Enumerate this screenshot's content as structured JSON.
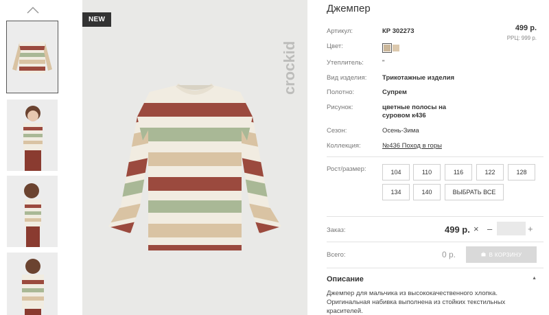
{
  "product": {
    "badge": "NEW",
    "brand": "crockid",
    "title": "Джемпер",
    "price": "499 р.",
    "rrc": "РРЦ: 999 р."
  },
  "details": [
    {
      "label": "Артикул:",
      "value": "КР 302273"
    },
    {
      "label": "Цвет:",
      "value": ""
    },
    {
      "label": "Утеплитель:",
      "value": "\""
    },
    {
      "label": "Вид изделия:",
      "value": "Трикотажные изделия"
    },
    {
      "label": "Полотно:",
      "value": "Супрем"
    },
    {
      "label": "Рисунок:",
      "value": "цветные полосы на суровом к436"
    },
    {
      "label": "Сезон:",
      "value": "Осень-Зима"
    },
    {
      "label": "Коллекция:",
      "value": "№436 Поход в горы"
    }
  ],
  "colors": [
    "#cbb79a",
    "#dcc9ae"
  ],
  "sizes": {
    "label": "Рост/размер:",
    "options": [
      "104",
      "110",
      "116",
      "122",
      "128",
      "134",
      "140"
    ],
    "select_all": "ВЫБРАТЬ ВСЕ"
  },
  "order": {
    "label": "Заказ:",
    "price": "499 р.",
    "multiply": "×",
    "minus": "–",
    "quantity": "",
    "plus": "+"
  },
  "total": {
    "label": "Всего:",
    "value": "0 р.",
    "cart_button": "В КОРЗИНУ"
  },
  "description": {
    "title": "Описание",
    "text": "Джемпер для мальчика из высококачественного хлопка. Оригинальная набивка выполнена из стойких текстильных красителей."
  },
  "stripe_colors": {
    "cream": "#f1ece1",
    "rust": "#9b4a3e",
    "sage": "#a9b896",
    "tan": "#d9c3a3"
  }
}
